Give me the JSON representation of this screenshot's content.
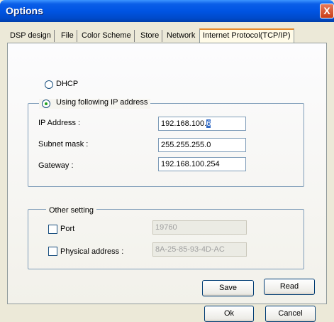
{
  "window": {
    "title": "Options",
    "close_glyph": "X"
  },
  "tabs": [
    {
      "label": "DSP design"
    },
    {
      "label": "File"
    },
    {
      "label": "Color Scheme"
    },
    {
      "label": "Store"
    },
    {
      "label": "Network"
    },
    {
      "label": "Internet Protocol(TCP/IP)",
      "active": true
    }
  ],
  "ip_mode": {
    "dhcp_label": "DHCP",
    "static_label": "Using following IP address",
    "selected": "static"
  },
  "static": {
    "ip_label": "IP Address :",
    "ip_value": "192.168.100.",
    "ip_value_selected": "6",
    "subnet_label": "Subnet mask :",
    "subnet_value": "255.255.255.0",
    "gateway_label": "Gateway :",
    "gateway_value": "192.168.100.254"
  },
  "other": {
    "legend": "Other setting",
    "port_label": "Port",
    "port_checked": false,
    "port_value": "19760",
    "mac_label": "Physical address :",
    "mac_checked": false,
    "mac_value": "8A-25-85-93-4D-AC"
  },
  "buttons": {
    "save": "Save",
    "read": "Read",
    "ok": "Ok",
    "cancel": "Cancel"
  },
  "colors": {
    "titlebar": "#0054e3",
    "active_tab_accent": "#e68b2c",
    "radio_dot": "#21a121"
  }
}
